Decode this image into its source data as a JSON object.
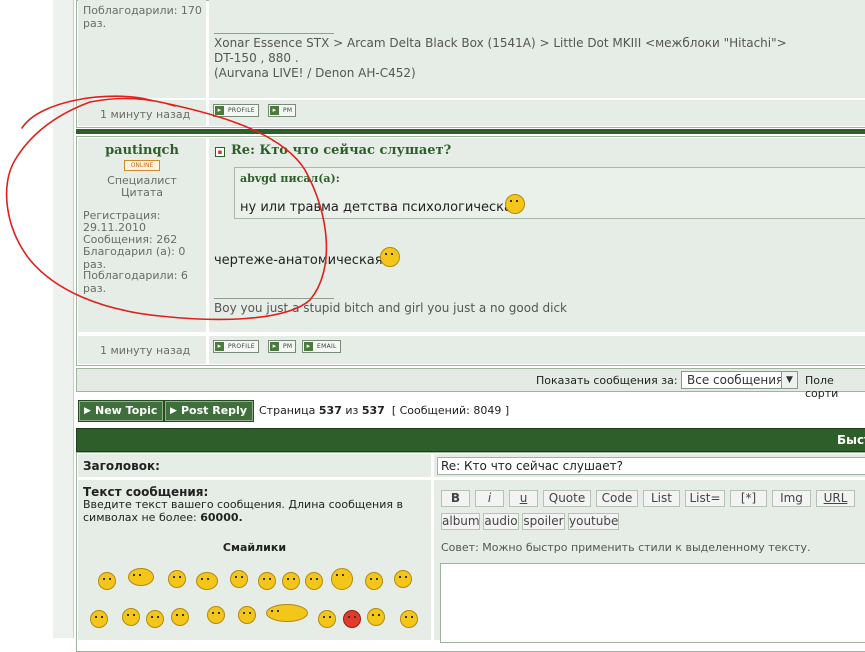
{
  "top_post": {
    "thanked_text": "Поблагодарили: 170 раз.",
    "signature_lines": [
      "Xonar Essence STX > Arcam Delta Black Box (1541A) > Little Dot MKIII <межблоки \"Hitachi\">",
      "DT-150 , 880 .",
      "(Aurvana LIVE! / Denon AH-C452)"
    ],
    "time": "1 минуту назад",
    "buttons": [
      "PROFILE",
      "PM"
    ]
  },
  "post2": {
    "username": "pautinqch",
    "online": "ONLINE",
    "rank": "Специалист",
    "quote_role": "Цитата",
    "reg_label": "Регистрация:",
    "reg_date": "29.11.2010",
    "messages": "Сообщения: 262",
    "thanked_by": "Благодарил (а): 0 раз.",
    "thanked": "Поблагодарили: 6 раз.",
    "title": "Re: Кто что сейчас слушает?",
    "quote_author": "abvgd писал(а):",
    "quote_text": "ну или травма детства психологическая",
    "body_text": "чертеже-анатомическая",
    "signature": "Boy you just a stupid bitch and girl you just a no good dick",
    "time": "1 минуту назад",
    "buttons": [
      "PROFILE",
      "PM",
      "EMAIL"
    ]
  },
  "filter": {
    "label": "Показать сообщения за:",
    "select_value": "Все сообщения",
    "sort_label": "Поле сорти"
  },
  "pagination": {
    "new_topic": "New Topic",
    "post_reply": "Post Reply",
    "page_label": "Страница",
    "current": "537",
    "of": "из",
    "total": "537",
    "messages_label": "[ Сообщений: 8049 ]"
  },
  "quick_reply": {
    "header": "Быст",
    "subject_label": "Заголовок:",
    "subject_value": "Re: Кто что сейчас слушает?",
    "message_label": "Текст сообщения:",
    "message_hint": "Введите текст вашего сообщения. Длина сообщения в символах не более:",
    "max_len": "60000.",
    "smilies_label": "Смайлики",
    "toolbar_row1": [
      "B",
      "i",
      "u",
      "Quote",
      "Code",
      "List",
      "List=",
      "[*]",
      "Img",
      "URL"
    ],
    "toolbar_row2": [
      "album",
      "audio",
      "spoiler",
      "youtube"
    ],
    "tip": "Совет: Можно быстро применить стили к выделенному тексту."
  },
  "colors": {
    "green_dark": "#2e5e2a",
    "panel": "#e6ede6",
    "annotation": "#e0201b"
  }
}
